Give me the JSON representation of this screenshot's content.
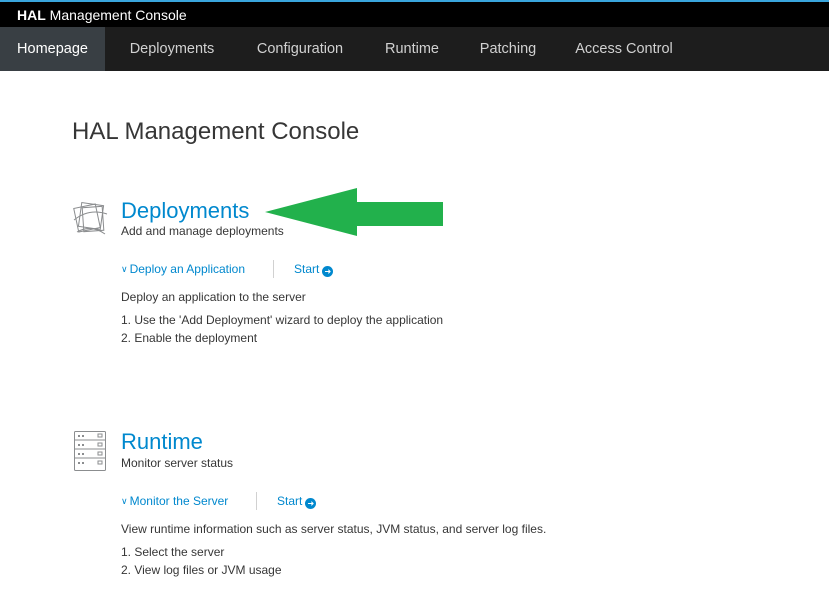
{
  "header": {
    "brand_bold": "HAL",
    "brand_rest": "Management Console"
  },
  "nav": {
    "items": [
      {
        "label": "Homepage",
        "active": true
      },
      {
        "label": "Deployments"
      },
      {
        "label": "Configuration"
      },
      {
        "label": "Runtime"
      },
      {
        "label": "Patching"
      },
      {
        "label": "Access Control"
      }
    ]
  },
  "main": {
    "title": "HAL Management Console",
    "sections": [
      {
        "title": "Deployments",
        "subtitle": "Add and manage deployments",
        "icon": "deployments-icon",
        "step_label": "Deploy an Application",
        "start_label": "Start",
        "description": "Deploy an application to the server",
        "steps": [
          "1. Use the 'Add Deployment' wizard to deploy the application",
          "2. Enable the deployment"
        ]
      },
      {
        "title": "Runtime",
        "subtitle": "Monitor server status",
        "icon": "server-rack-icon",
        "step_label": "Monitor the Server",
        "start_label": "Start",
        "description": "View runtime information such as server status, JVM status, and server log files.",
        "steps": [
          "1. Select the server",
          "2. View log files or JVM usage"
        ]
      }
    ]
  },
  "annotation": {
    "arrow_icon": "green-arrow-left-icon",
    "arrow_color": "#22b14c"
  },
  "colors": {
    "accent": "#0088ce",
    "topbar_border": "#39a5dc",
    "navbar_bg": "#1d1d1d",
    "nav_active_bg": "#393f44"
  }
}
